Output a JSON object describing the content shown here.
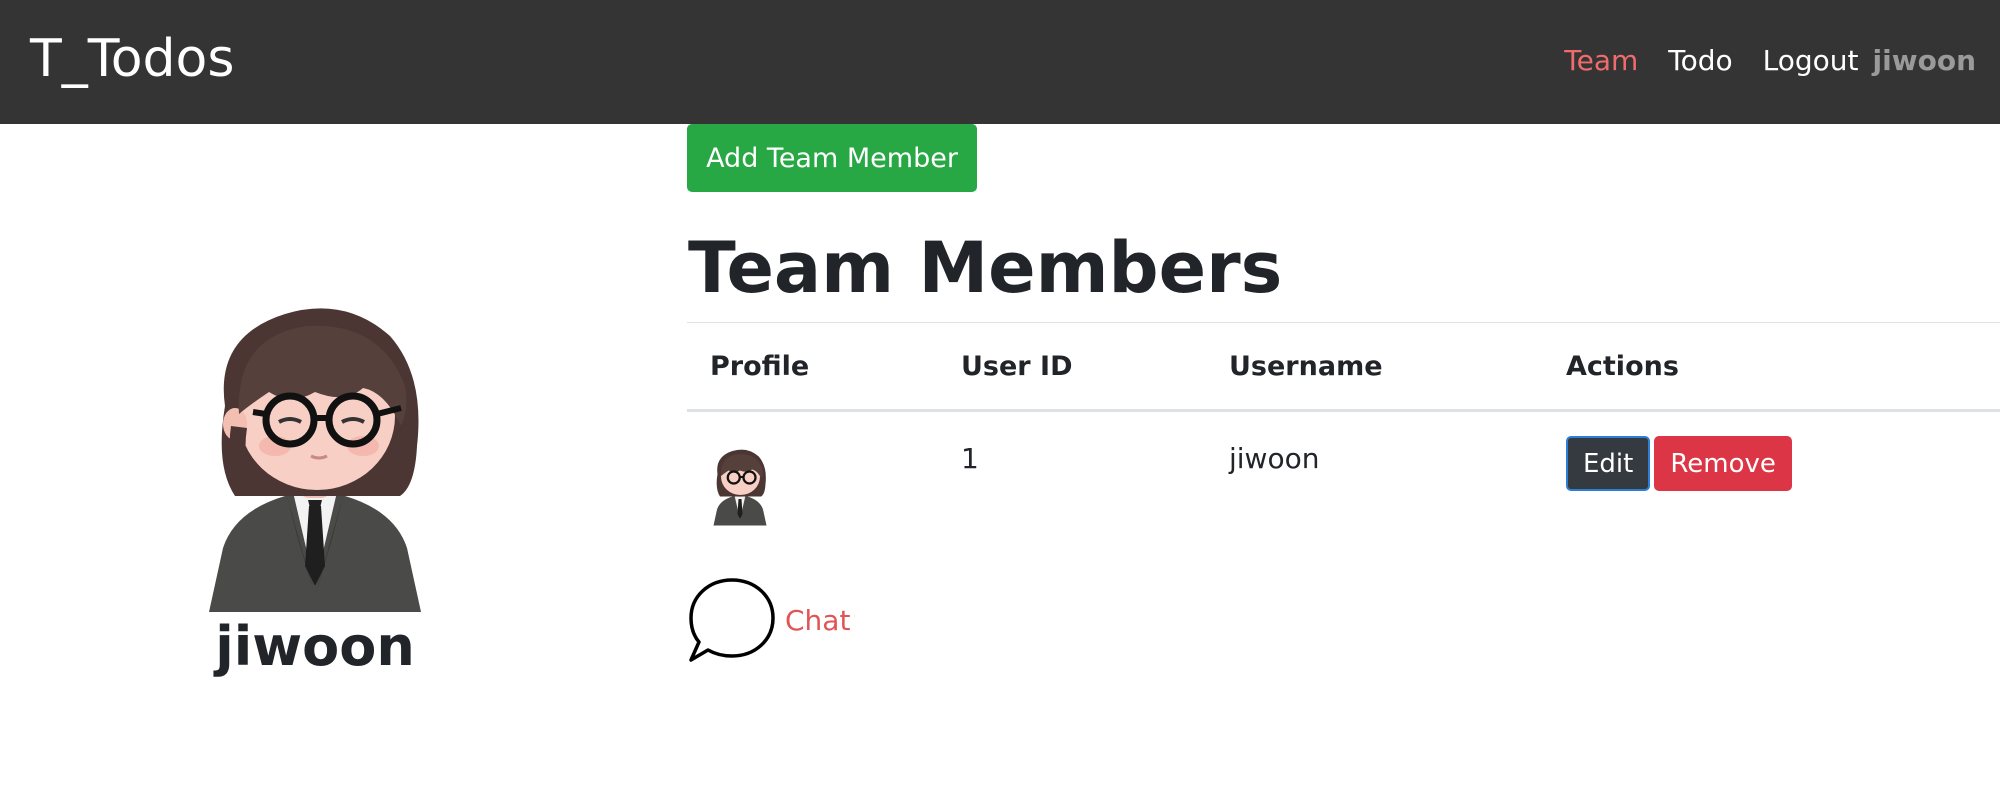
{
  "navbar": {
    "brand": "T_Todos",
    "links": [
      "Team",
      "Todo",
      "Logout"
    ],
    "username": "jiwoon",
    "active_color": "#f06b6b"
  },
  "profile": {
    "name": "jiwoon"
  },
  "main": {
    "add_button_label": "Add Team Member",
    "title": "Team Members",
    "table": {
      "headers": [
        "Profile",
        "User ID",
        "Username",
        "Actions"
      ],
      "rows": [
        {
          "user_id": "1",
          "username": "jiwoon",
          "edit_label": "Edit",
          "remove_label": "Remove"
        }
      ]
    },
    "chat_label": "Chat"
  },
  "colors": {
    "navbar_bg": "#343434",
    "success": "#28a745",
    "danger": "#dc3545",
    "dark": "#343a40",
    "link_red": "#e05555"
  },
  "icons": {
    "chat": "speech-bubble-icon",
    "avatar": "user-avatar"
  }
}
